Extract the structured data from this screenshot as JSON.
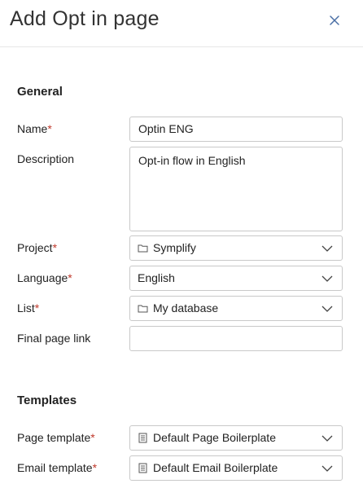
{
  "dialog": {
    "title": "Add Opt in page"
  },
  "sections": {
    "general": "General",
    "templates": "Templates"
  },
  "fields": {
    "name": {
      "label": "Name",
      "required": "*",
      "value": "Optin ENG"
    },
    "description": {
      "label": "Description",
      "value": "Opt-in flow in English"
    },
    "project": {
      "label": "Project",
      "required": "*",
      "value": "Symplify",
      "icon": "folder-icon"
    },
    "language": {
      "label": "Language",
      "required": "*",
      "value": "English"
    },
    "list": {
      "label": "List",
      "required": "*",
      "value": "My database",
      "icon": "folder-icon"
    },
    "final_page_link": {
      "label": "Final page link",
      "value": ""
    },
    "page_template": {
      "label": "Page template",
      "required": "*",
      "value": "Default Page Boilerplate",
      "icon": "template-icon"
    },
    "email_template": {
      "label": "Email template",
      "required": "*",
      "value": "Default Email Boilerplate",
      "icon": "template-icon"
    }
  },
  "colors": {
    "required": "#c0392b",
    "border": "#c9c9c9",
    "close_icon": "#4a6fa5"
  }
}
